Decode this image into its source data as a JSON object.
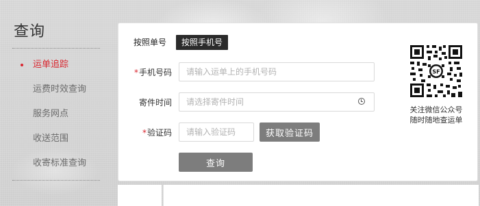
{
  "sidebar": {
    "title": "查询",
    "items": [
      {
        "label": "运单追踪",
        "active": true
      },
      {
        "label": "运费时效查询",
        "active": false
      },
      {
        "label": "服务网点",
        "active": false
      },
      {
        "label": "收送范围",
        "active": false
      },
      {
        "label": "收寄标准查询",
        "active": false
      }
    ]
  },
  "tabs": [
    {
      "label": "按照单号",
      "active": false
    },
    {
      "label": "按照手机号",
      "active": true
    }
  ],
  "form": {
    "phone": {
      "label": "手机号码",
      "required": true,
      "placeholder": "请输入运单上的手机号码",
      "value": ""
    },
    "send_time": {
      "label": "寄件时间",
      "required": false,
      "placeholder": "请选择寄件时间",
      "value": "",
      "icon": "clock-icon"
    },
    "captcha": {
      "label": "验证码",
      "required": true,
      "placeholder": "请输入验证码",
      "value": ""
    },
    "get_code_label": "获取验证码",
    "submit_label": "查询"
  },
  "qr": {
    "line1": "关注微信公众号",
    "line2": "随时随地查运单"
  },
  "colors": {
    "accent": "#d9262f",
    "button": "#7d7d7d",
    "tab_active": "#2b2b2b"
  }
}
